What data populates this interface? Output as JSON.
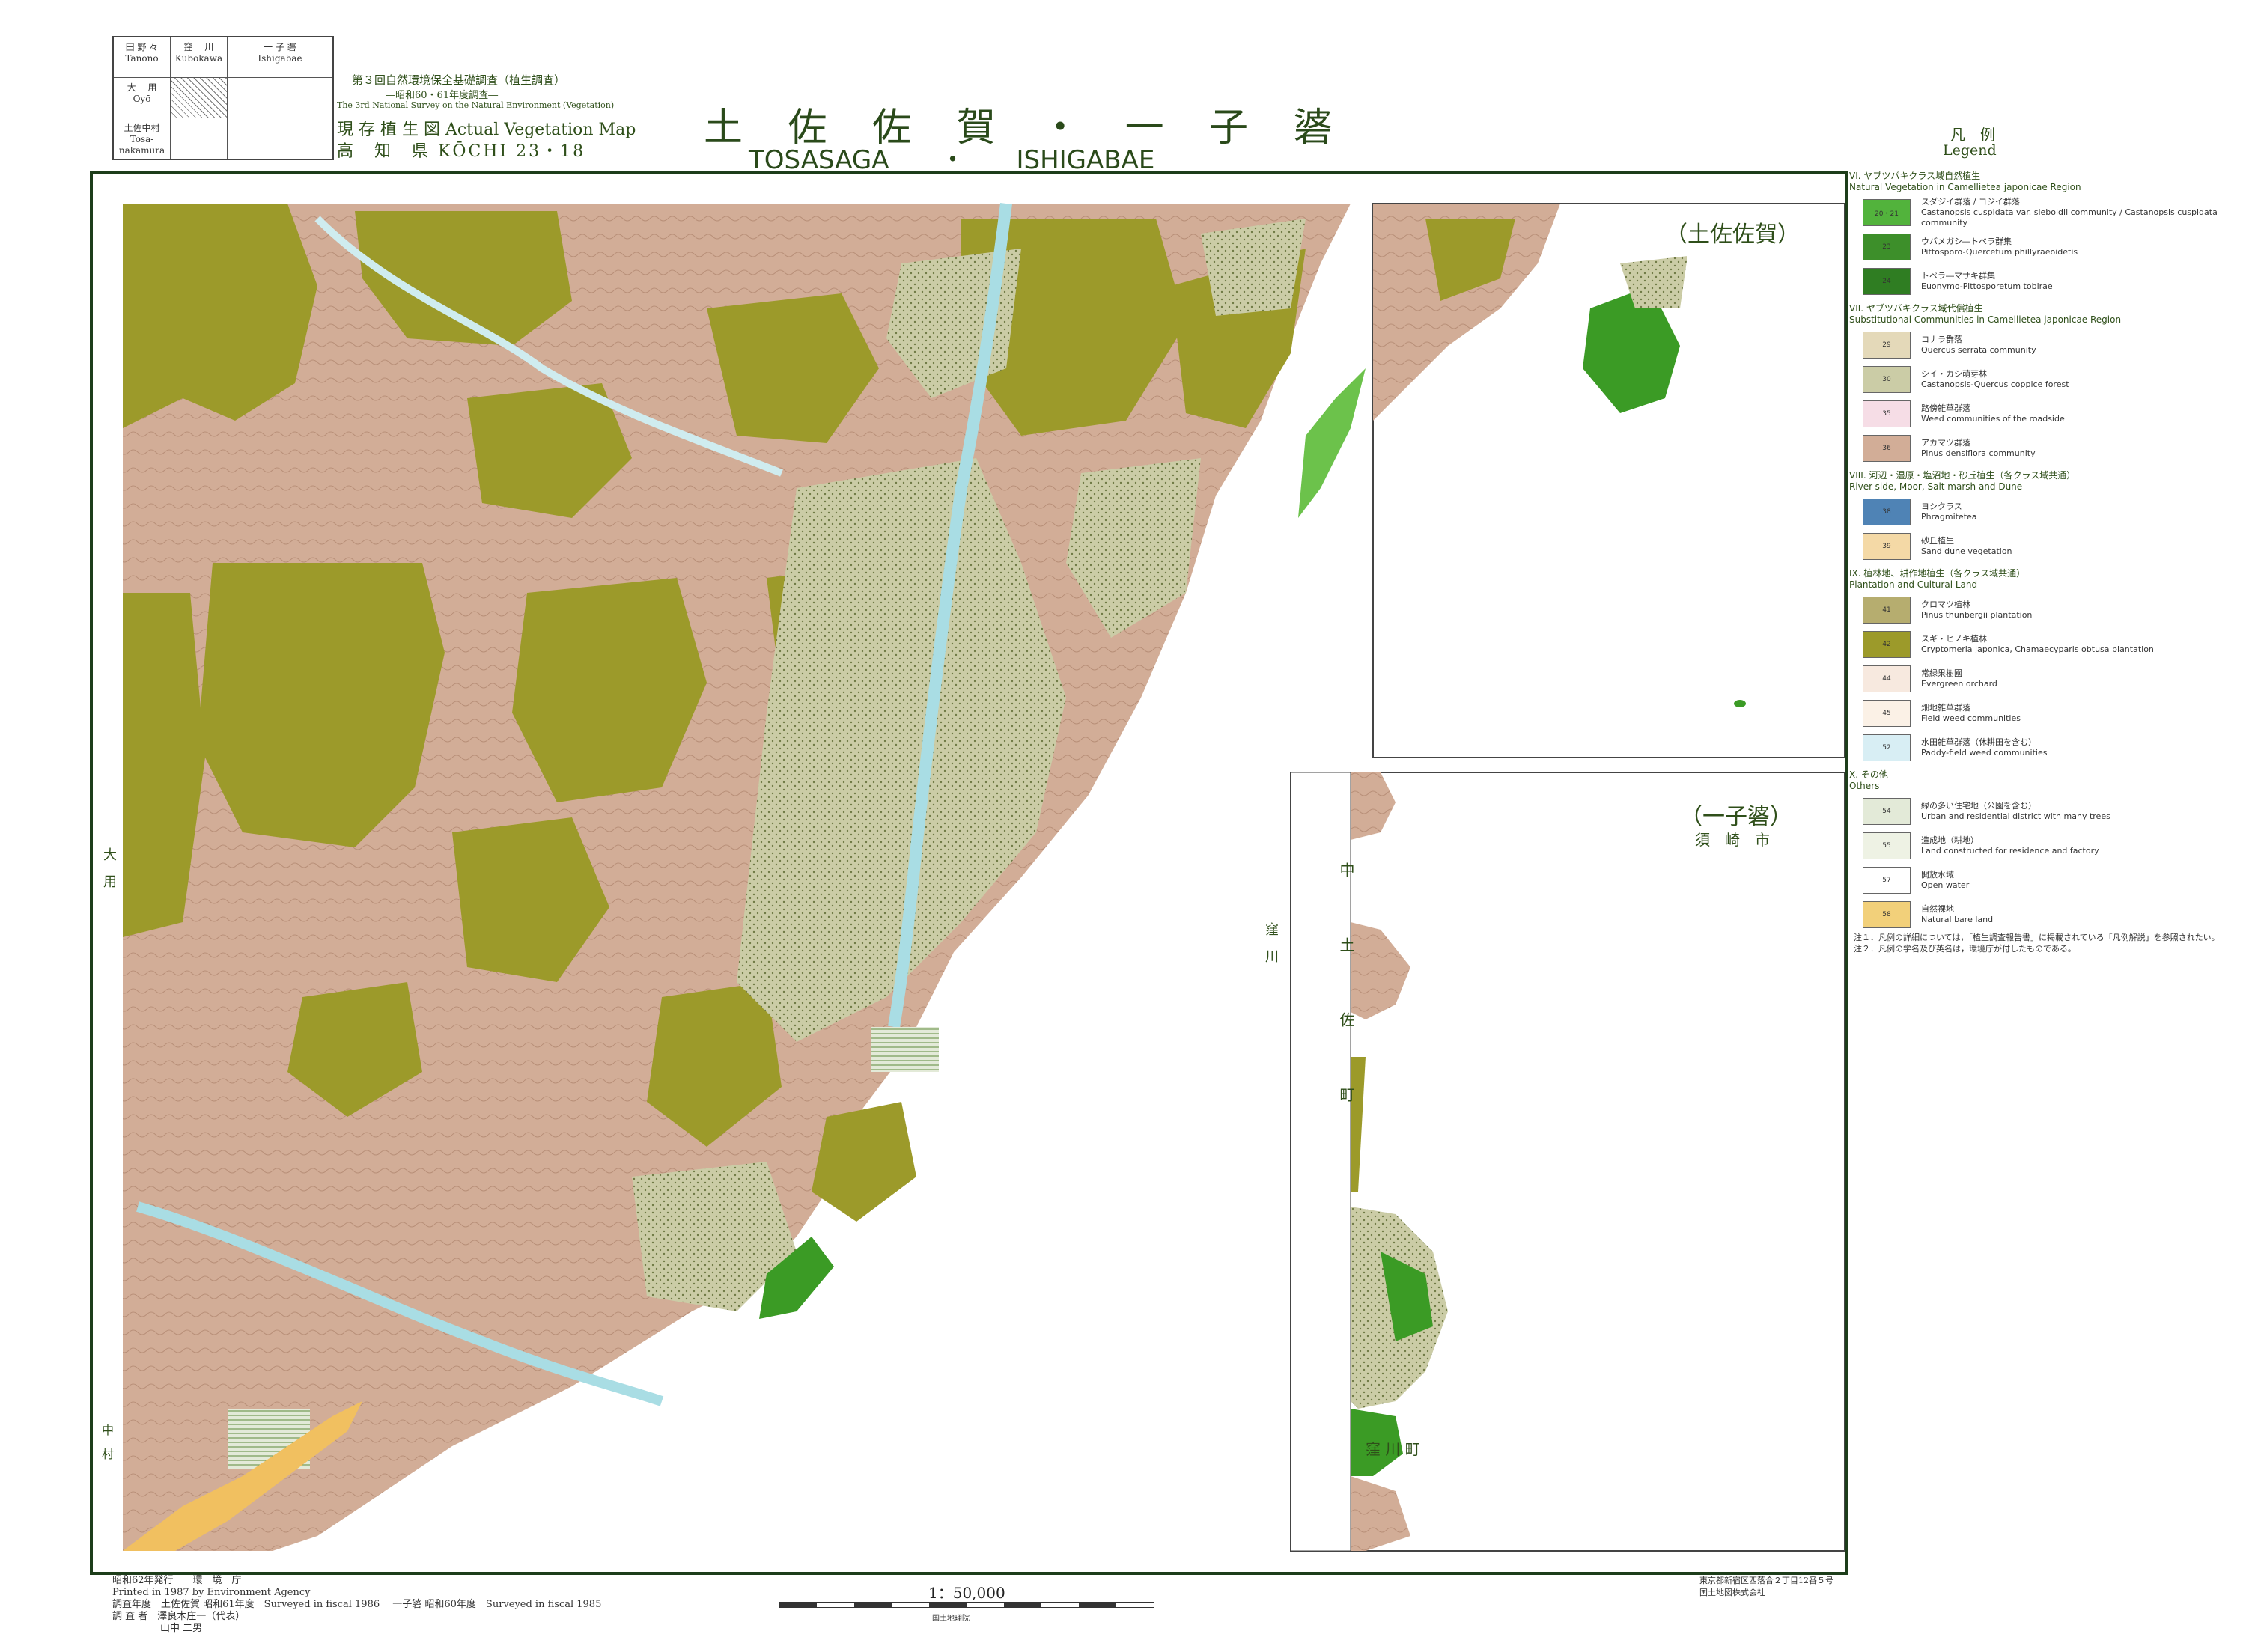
{
  "index_sheet": {
    "cells": [
      {
        "jp": "田 野 々",
        "en": "Tanono"
      },
      {
        "jp": "窪　 川",
        "en": "Kubokawa"
      },
      {
        "jp": "一 子 碆",
        "en": "Ishigabae"
      },
      {
        "jp": "大　 用",
        "en": "Ōyō"
      },
      {
        "jp": "",
        "en": ""
      },
      {
        "jp": "",
        "en": ""
      },
      {
        "jp": "土佐中村",
        "en": "Tosa-nakamura"
      },
      {
        "jp": "",
        "en": ""
      },
      {
        "jp": "",
        "en": ""
      }
    ]
  },
  "header": {
    "survey_title": "第３回自然環境保全基礎調査（植生調査）",
    "survey_years": "―昭和60・61年度調査―",
    "survey_en": "The 3rd National Survey on the Natural Environment (Vegetation)",
    "map_type": "現 存 植 生 図 Actual Vegetation Map",
    "prefecture": "高　知　県 KŌCHI 23・18",
    "title_jp": "土 佐 佐 賀 ・ 一 子 碆",
    "title_en": "TOSASAGA　　・　　ISHIGABAE",
    "legend_jp": "凡　例",
    "legend_en": "Legend"
  },
  "map": {
    "inset_top_label": "（土佐佐賀）",
    "inset_bottom_label": "（一子碆）",
    "inset_bottom_sub": "須　崎　市",
    "places": [
      "大　用",
      "窪　川",
      "中　土　佐　町",
      "窪 川 町",
      "中　村"
    ]
  },
  "colors": {
    "frame": "#1d3d1a",
    "plantation": "#9c9a2a",
    "pine": "#d2ad97",
    "coppice": "#cbcca6",
    "natural_green": "#3b9b25",
    "light_green": "#6cc24b",
    "water": "#cfecef",
    "sea": "#ffffff",
    "sand": "#f1c060"
  },
  "legend": {
    "sections": [
      {
        "title": "VI. ヤブツバキクラス域自然植生\nNatural Vegetation in Camellietea japonicae Region",
        "items": [
          {
            "code": "20・21",
            "color": "#52b33c",
            "label": "スダジイ群落 / コジイ群落\nCastanopsis cuspidata var. sieboldii community / Castanopsis cuspidata community"
          },
          {
            "code": "23",
            "color": "#3d8f2a",
            "label": "ウバメガシ―トベラ群集\nPittosporo-Quercetum phillyraeoidetis"
          },
          {
            "code": "24",
            "color": "#2f7d22",
            "label": "トベラ―マサキ群集\nEuonymo-Pittosporetum tobirae"
          }
        ]
      },
      {
        "title": "VII. ヤブツバキクラス域代償植生\nSubstitutional Communities in Camellietea japonicae Region",
        "items": [
          {
            "code": "29",
            "color": "#e4d9b9",
            "label": "コナラ群落\nQuercus serrata community"
          },
          {
            "code": "30",
            "color": "#cbcca6",
            "label": "シイ・カシ萌芽林\nCastanopsis-Quercus coppice forest"
          },
          {
            "code": "35",
            "color": "#f6dde6",
            "label": "路傍雑草群落\nWeed communities of the roadside"
          },
          {
            "code": "36",
            "color": "#d2ad97",
            "label": "アカマツ群落\nPinus densiflora community"
          }
        ]
      },
      {
        "title": "VIII. 河辺・湿原・塩沼地・砂丘植生（各クラス域共通）\nRiver-side, Moor, Salt marsh and Dune",
        "items": [
          {
            "code": "38",
            "color": "#4f83b5",
            "label": "ヨシクラス\nPhragmitetea"
          },
          {
            "code": "39",
            "color": "#f4d9a6",
            "label": "砂丘植生\nSand dune vegetation"
          }
        ]
      },
      {
        "title": "IX. 植林地、耕作地植生（各クラス域共通）\nPlantation and Cultural Land",
        "items": [
          {
            "code": "41",
            "color": "#b6ad6f",
            "label": "クロマツ植林\nPinus thunbergii plantation"
          },
          {
            "code": "42",
            "color": "#9c9a2a",
            "label": "スギ・ヒノキ植林\nCryptomeria japonica, Chamaecyparis obtusa plantation"
          },
          {
            "code": "44",
            "color": "#f7e9df",
            "label": "常緑果樹園\nEvergreen orchard"
          },
          {
            "code": "45",
            "color": "#fbf1e6",
            "label": "畑地雑草群落\nField weed communities"
          },
          {
            "code": "52",
            "color": "#d8eef4",
            "label": "水田雑草群落（休耕田を含む）\nPaddy-field weed communities"
          }
        ]
      },
      {
        "title": "X. その他\nOthers",
        "items": [
          {
            "code": "54",
            "color": "#e3ead8",
            "label": "緑の多い住宅地（公園を含む）\nUrban and residential district with many trees"
          },
          {
            "code": "55",
            "color": "#eef2e4",
            "label": "造成地（耕地）\nLand constructed for residence and factory"
          },
          {
            "code": "57",
            "color": "#ffffff",
            "label": "開放水域\nOpen water"
          },
          {
            "code": "58",
            "color": "#f2d07a",
            "label": "自然裸地\nNatural bare land"
          }
        ]
      }
    ],
    "notes": [
      "注１．凡例の詳細については，「植生調査報告書」に掲載されている「凡例解説」を参照されたい。",
      "注２．凡例の学名及び英名は，環境庁が付したものである。"
    ]
  },
  "footer": {
    "published_jp": "昭和62年発行　　環　境　庁",
    "printed_en": "Printed in 1987 by Environment Agency",
    "survey_line": "調査年度　土佐佐賀 昭和61年度　Surveyed in fiscal 1986　 一子碆 昭和60年度　Surveyed in fiscal 1985",
    "investigators_1": "調 査 者　澤良木庄一（代表）",
    "investigators_2": "山中 二男",
    "scale": "1：50,000",
    "scale_note": "国土地理院",
    "printer_1": "東京都新宿区西落合２丁目12番５号",
    "printer_2": "国土地図株式会社"
  }
}
